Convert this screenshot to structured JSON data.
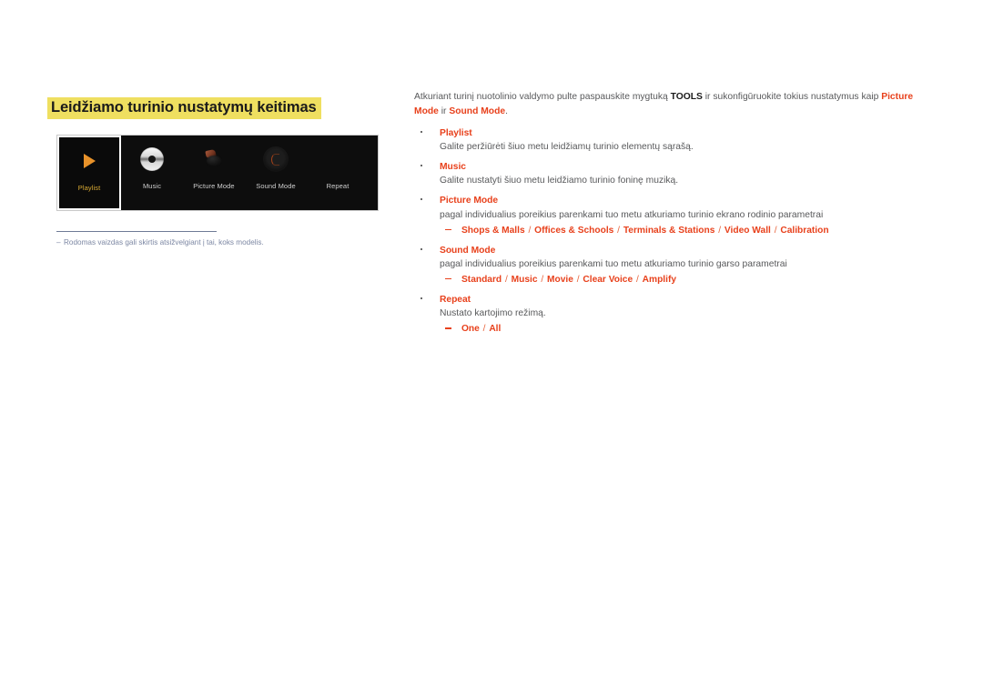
{
  "page": {
    "title": "Leidžiamo turinio nustatymų keitimas",
    "title_highlight_color": "#efdf60"
  },
  "osd_panel": {
    "background_color": "#0d0d0d",
    "selected_label_color": "#d8a933",
    "items": [
      {
        "label": "Playlist",
        "icon": "play-icon",
        "selected": true
      },
      {
        "label": "Music",
        "icon": "disc-icon",
        "selected": false
      },
      {
        "label": "Picture Mode",
        "icon": "picture-mode-icon",
        "selected": false
      },
      {
        "label": "Sound Mode",
        "icon": "sound-knob-icon",
        "selected": false
      },
      {
        "label": "Repeat",
        "icon": "repeat-icon",
        "selected": false
      }
    ]
  },
  "footnote": {
    "dash": "‒",
    "text": "Rodomas vaizdas gali skirtis atsižvelgiant į tai, koks modelis."
  },
  "intro": {
    "part1": "Atkuriant turinį nuotolinio valdymo pulte paspauskite mygtuką ",
    "tools": "TOOLS",
    "part2": " ir sukonfigūruokite tokius nustatymus kaip ",
    "picture_mode": "Picture Mode",
    "part3": " ir ",
    "sound_mode": "Sound Mode",
    "part4": "."
  },
  "bullets": [
    {
      "title": "Playlist",
      "desc": "Galite peržiūrėti šiuo metu leidžiamų turinio elementų sąrašą.",
      "options": []
    },
    {
      "title": "Music",
      "desc": "Galite nustatyti šiuo metu leidžiamo turinio foninę muziką.",
      "options": []
    },
    {
      "title": "Picture Mode",
      "desc": "pagal individualius poreikius parenkami tuo metu atkuriamo turinio ekrano rodinio parametrai",
      "options": [
        "Shops & Malls",
        "Offices & Schools",
        "Terminals & Stations",
        "Video Wall",
        "Calibration"
      ]
    },
    {
      "title": "Sound Mode",
      "desc": "pagal individualius poreikius parenkami tuo metu atkuriamo turinio garso parametrai",
      "options": [
        "Standard",
        "Music",
        "Movie",
        "Clear Voice",
        "Amplify"
      ]
    },
    {
      "title": "Repeat",
      "desc": "Nustato kartojimo režimą.",
      "options": [
        "One",
        "All"
      ]
    }
  ],
  "colors": {
    "accent_red": "#e8411c",
    "body_gray": "#58595b",
    "note_blue": "#7c87a3"
  }
}
